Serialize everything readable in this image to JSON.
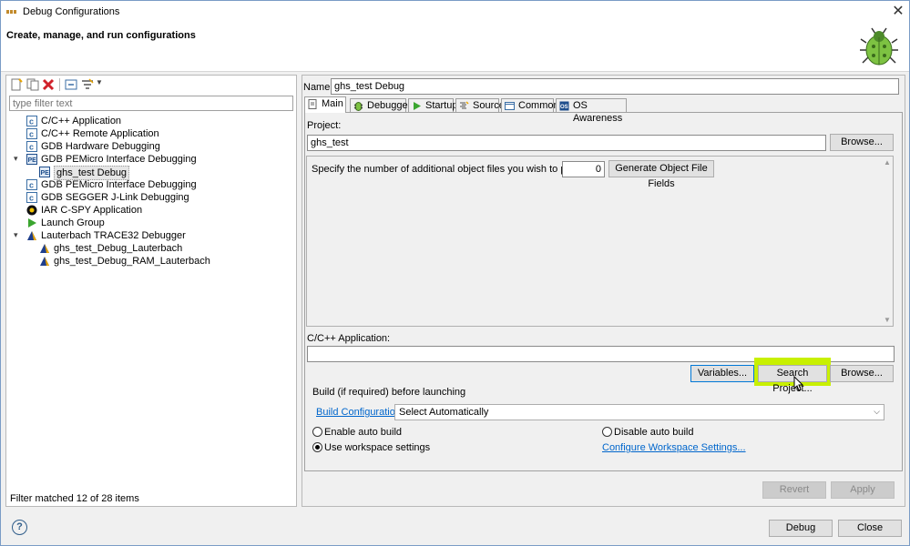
{
  "window": {
    "title": "Debug Configurations",
    "header_title": "Create, manage, and run configurations"
  },
  "left": {
    "filter_placeholder": "type filter text",
    "tree": [
      {
        "label": "C/C++ Application",
        "icon": "c-app-icon"
      },
      {
        "label": "C/C++ Remote Application",
        "icon": "c-app-icon"
      },
      {
        "label": "GDB Hardware Debugging",
        "icon": "c-app-icon"
      },
      {
        "label": "GDB PEMicro Interface Debugging",
        "icon": "pemicro-icon",
        "expanded": true
      },
      {
        "label": "ghs_test Debug",
        "icon": "pemicro-icon",
        "selected": true
      },
      {
        "label": "GDB PEMicro Interface Debugging",
        "icon": "c-app-icon"
      },
      {
        "label": "GDB SEGGER J-Link Debugging",
        "icon": "c-app-icon"
      },
      {
        "label": "IAR C-SPY Application",
        "icon": "iar-icon"
      },
      {
        "label": "Launch Group",
        "icon": "launch-group-icon"
      },
      {
        "label": "Lauterbach TRACE32 Debugger",
        "icon": "lauterbach-icon",
        "expanded": true
      },
      {
        "label": "ghs_test_Debug_Lauterbach",
        "icon": "lauterbach-icon"
      },
      {
        "label": "ghs_test_Debug_RAM_Lauterbach",
        "icon": "lauterbach-icon"
      }
    ],
    "filter_status": "Filter matched 12 of 28 items"
  },
  "right": {
    "name_label": "Name:",
    "name_value": "ghs_test Debug",
    "tabs": [
      "Main",
      "Debugger",
      "Startup",
      "Source",
      "Common",
      "OS Awareness"
    ],
    "project_label": "Project:",
    "project_value": "ghs_test",
    "browse_label": "Browse...",
    "object_files_label": "Specify the number of additional object files you wish to program:",
    "object_files_value": "0",
    "generate_label": "Generate Object File Fields",
    "app_label": "C/C++ Application:",
    "app_value": "",
    "variables_label": "Variables...",
    "search_project_label": "Search Project...",
    "browse2_label": "Browse...",
    "build_section_label": "Build (if required) before launching",
    "build_config_label": "Build Configuration:",
    "build_config_value": "Select Automatically",
    "enable_auto_build": "Enable auto build",
    "disable_auto_build": "Disable auto build",
    "use_workspace": "Use workspace settings",
    "configure_workspace": "Configure Workspace Settings...",
    "revert_label": "Revert",
    "apply_label": "Apply"
  },
  "footer": {
    "debug_label": "Debug",
    "close_label": "Close"
  },
  "colors": {
    "highlight": "#c8f000",
    "link": "#0066cc",
    "accent_border": "#0078d7"
  }
}
